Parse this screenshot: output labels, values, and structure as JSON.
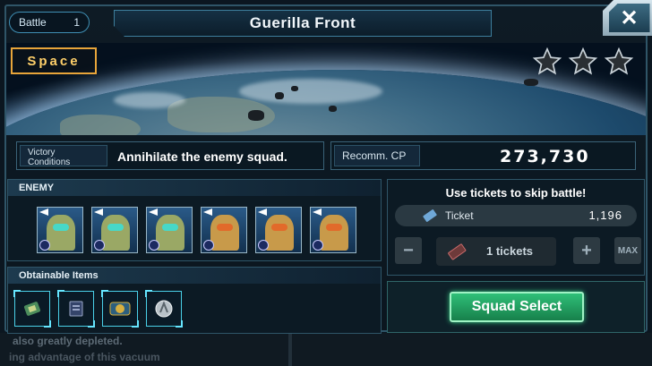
{
  "background_text": {
    "line1": "also greatly depleted.",
    "line2": "ing advantage of this vacuum"
  },
  "header": {
    "battle_label": "Battle",
    "battle_number": "1",
    "title": "Guerilla Front",
    "close_icon": "close-x-icon"
  },
  "banner": {
    "location": "Space",
    "stars_total": 3,
    "stars_earned": 0
  },
  "victory": {
    "label_line1": "Victory",
    "label_line2": "Conditions",
    "value": "Annihilate the enemy squad."
  },
  "recommended": {
    "label": "Recomm. CP",
    "value": "273,730"
  },
  "enemy_section": {
    "title": "ENEMY",
    "units": [
      {
        "type": "green-mobile-suit",
        "color": "#9aa865",
        "visor": "#47d8c8"
      },
      {
        "type": "green-mobile-suit",
        "color": "#9aa865",
        "visor": "#47d8c8"
      },
      {
        "type": "green-mobile-suit",
        "color": "#9aa865",
        "visor": "#47d8c8"
      },
      {
        "type": "orange-mobile-suit",
        "color": "#c89a4a",
        "visor": "#e26a2a"
      },
      {
        "type": "orange-mobile-suit",
        "color": "#c89a4a",
        "visor": "#e26a2a"
      },
      {
        "type": "orange-mobile-suit",
        "color": "#c89a4a",
        "visor": "#e26a2a"
      }
    ]
  },
  "items_section": {
    "title": "Obtainable Items",
    "items": [
      "circuit-chip-icon",
      "data-card-icon",
      "ticket-badge-icon",
      "silver-medal-icon"
    ]
  },
  "tickets": {
    "title": "Use tickets to skip battle!",
    "label": "Ticket",
    "owned": "1,196",
    "selected_text": "1 tickets",
    "minus": "−",
    "plus": "+",
    "max": "MAX"
  },
  "squad_button": "Squad Select",
  "colors": {
    "accent": "#3f8fb4",
    "squad_green": "#2fbf78",
    "space_tag": "#ffd06a"
  }
}
